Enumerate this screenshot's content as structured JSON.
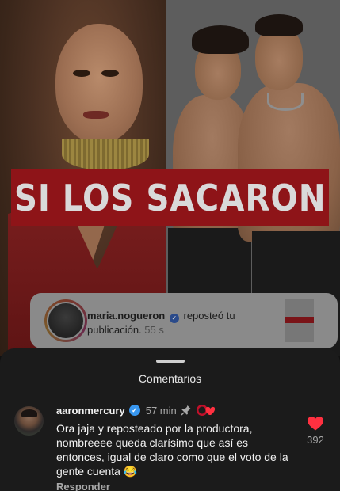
{
  "post": {
    "headline": "SI LOS SACARON",
    "repost": {
      "username": "maria.nogueron",
      "action": "reposteó tu publicación.",
      "time": "55 s"
    }
  },
  "comments_sheet": {
    "title": "Comentarios",
    "comment": {
      "username": "aaronmercury",
      "verified": true,
      "time": "57 min",
      "pinned": true,
      "liked_by_author": true,
      "text": "Ora jaja y reposteado por la productora, nombreeee queda clarísimo que así es entonces, igual de claro como que el voto de la gente cuenta 😂",
      "reply_label": "Responder",
      "likes": "392"
    }
  },
  "colors": {
    "sheet_bg": "#1b1b1b",
    "verified_blue": "#3897f0",
    "heart_red": "#ff3040",
    "headline_red": "#8e1418"
  },
  "icons": [
    "verified-badge-icon",
    "pin-icon",
    "author-liked-icon",
    "heart-icon"
  ]
}
